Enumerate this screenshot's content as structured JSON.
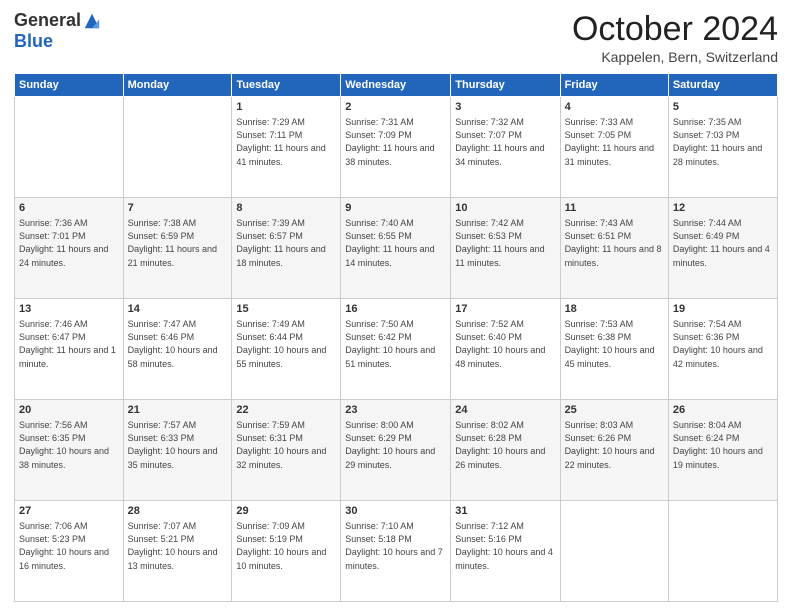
{
  "logo": {
    "general": "General",
    "blue": "Blue"
  },
  "header": {
    "month": "October 2024",
    "location": "Kappelen, Bern, Switzerland"
  },
  "weekdays": [
    "Sunday",
    "Monday",
    "Tuesday",
    "Wednesday",
    "Thursday",
    "Friday",
    "Saturday"
  ],
  "weeks": [
    [
      {
        "day": "",
        "sunrise": "",
        "sunset": "",
        "daylight": ""
      },
      {
        "day": "",
        "sunrise": "",
        "sunset": "",
        "daylight": ""
      },
      {
        "day": "1",
        "sunrise": "Sunrise: 7:29 AM",
        "sunset": "Sunset: 7:11 PM",
        "daylight": "Daylight: 11 hours and 41 minutes."
      },
      {
        "day": "2",
        "sunrise": "Sunrise: 7:31 AM",
        "sunset": "Sunset: 7:09 PM",
        "daylight": "Daylight: 11 hours and 38 minutes."
      },
      {
        "day": "3",
        "sunrise": "Sunrise: 7:32 AM",
        "sunset": "Sunset: 7:07 PM",
        "daylight": "Daylight: 11 hours and 34 minutes."
      },
      {
        "day": "4",
        "sunrise": "Sunrise: 7:33 AM",
        "sunset": "Sunset: 7:05 PM",
        "daylight": "Daylight: 11 hours and 31 minutes."
      },
      {
        "day": "5",
        "sunrise": "Sunrise: 7:35 AM",
        "sunset": "Sunset: 7:03 PM",
        "daylight": "Daylight: 11 hours and 28 minutes."
      }
    ],
    [
      {
        "day": "6",
        "sunrise": "Sunrise: 7:36 AM",
        "sunset": "Sunset: 7:01 PM",
        "daylight": "Daylight: 11 hours and 24 minutes."
      },
      {
        "day": "7",
        "sunrise": "Sunrise: 7:38 AM",
        "sunset": "Sunset: 6:59 PM",
        "daylight": "Daylight: 11 hours and 21 minutes."
      },
      {
        "day": "8",
        "sunrise": "Sunrise: 7:39 AM",
        "sunset": "Sunset: 6:57 PM",
        "daylight": "Daylight: 11 hours and 18 minutes."
      },
      {
        "day": "9",
        "sunrise": "Sunrise: 7:40 AM",
        "sunset": "Sunset: 6:55 PM",
        "daylight": "Daylight: 11 hours and 14 minutes."
      },
      {
        "day": "10",
        "sunrise": "Sunrise: 7:42 AM",
        "sunset": "Sunset: 6:53 PM",
        "daylight": "Daylight: 11 hours and 11 minutes."
      },
      {
        "day": "11",
        "sunrise": "Sunrise: 7:43 AM",
        "sunset": "Sunset: 6:51 PM",
        "daylight": "Daylight: 11 hours and 8 minutes."
      },
      {
        "day": "12",
        "sunrise": "Sunrise: 7:44 AM",
        "sunset": "Sunset: 6:49 PM",
        "daylight": "Daylight: 11 hours and 4 minutes."
      }
    ],
    [
      {
        "day": "13",
        "sunrise": "Sunrise: 7:46 AM",
        "sunset": "Sunset: 6:47 PM",
        "daylight": "Daylight: 11 hours and 1 minute."
      },
      {
        "day": "14",
        "sunrise": "Sunrise: 7:47 AM",
        "sunset": "Sunset: 6:46 PM",
        "daylight": "Daylight: 10 hours and 58 minutes."
      },
      {
        "day": "15",
        "sunrise": "Sunrise: 7:49 AM",
        "sunset": "Sunset: 6:44 PM",
        "daylight": "Daylight: 10 hours and 55 minutes."
      },
      {
        "day": "16",
        "sunrise": "Sunrise: 7:50 AM",
        "sunset": "Sunset: 6:42 PM",
        "daylight": "Daylight: 10 hours and 51 minutes."
      },
      {
        "day": "17",
        "sunrise": "Sunrise: 7:52 AM",
        "sunset": "Sunset: 6:40 PM",
        "daylight": "Daylight: 10 hours and 48 minutes."
      },
      {
        "day": "18",
        "sunrise": "Sunrise: 7:53 AM",
        "sunset": "Sunset: 6:38 PM",
        "daylight": "Daylight: 10 hours and 45 minutes."
      },
      {
        "day": "19",
        "sunrise": "Sunrise: 7:54 AM",
        "sunset": "Sunset: 6:36 PM",
        "daylight": "Daylight: 10 hours and 42 minutes."
      }
    ],
    [
      {
        "day": "20",
        "sunrise": "Sunrise: 7:56 AM",
        "sunset": "Sunset: 6:35 PM",
        "daylight": "Daylight: 10 hours and 38 minutes."
      },
      {
        "day": "21",
        "sunrise": "Sunrise: 7:57 AM",
        "sunset": "Sunset: 6:33 PM",
        "daylight": "Daylight: 10 hours and 35 minutes."
      },
      {
        "day": "22",
        "sunrise": "Sunrise: 7:59 AM",
        "sunset": "Sunset: 6:31 PM",
        "daylight": "Daylight: 10 hours and 32 minutes."
      },
      {
        "day": "23",
        "sunrise": "Sunrise: 8:00 AM",
        "sunset": "Sunset: 6:29 PM",
        "daylight": "Daylight: 10 hours and 29 minutes."
      },
      {
        "day": "24",
        "sunrise": "Sunrise: 8:02 AM",
        "sunset": "Sunset: 6:28 PM",
        "daylight": "Daylight: 10 hours and 26 minutes."
      },
      {
        "day": "25",
        "sunrise": "Sunrise: 8:03 AM",
        "sunset": "Sunset: 6:26 PM",
        "daylight": "Daylight: 10 hours and 22 minutes."
      },
      {
        "day": "26",
        "sunrise": "Sunrise: 8:04 AM",
        "sunset": "Sunset: 6:24 PM",
        "daylight": "Daylight: 10 hours and 19 minutes."
      }
    ],
    [
      {
        "day": "27",
        "sunrise": "Sunrise: 7:06 AM",
        "sunset": "Sunset: 5:23 PM",
        "daylight": "Daylight: 10 hours and 16 minutes."
      },
      {
        "day": "28",
        "sunrise": "Sunrise: 7:07 AM",
        "sunset": "Sunset: 5:21 PM",
        "daylight": "Daylight: 10 hours and 13 minutes."
      },
      {
        "day": "29",
        "sunrise": "Sunrise: 7:09 AM",
        "sunset": "Sunset: 5:19 PM",
        "daylight": "Daylight: 10 hours and 10 minutes."
      },
      {
        "day": "30",
        "sunrise": "Sunrise: 7:10 AM",
        "sunset": "Sunset: 5:18 PM",
        "daylight": "Daylight: 10 hours and 7 minutes."
      },
      {
        "day": "31",
        "sunrise": "Sunrise: 7:12 AM",
        "sunset": "Sunset: 5:16 PM",
        "daylight": "Daylight: 10 hours and 4 minutes."
      },
      {
        "day": "",
        "sunrise": "",
        "sunset": "",
        "daylight": ""
      },
      {
        "day": "",
        "sunrise": "",
        "sunset": "",
        "daylight": ""
      }
    ]
  ]
}
